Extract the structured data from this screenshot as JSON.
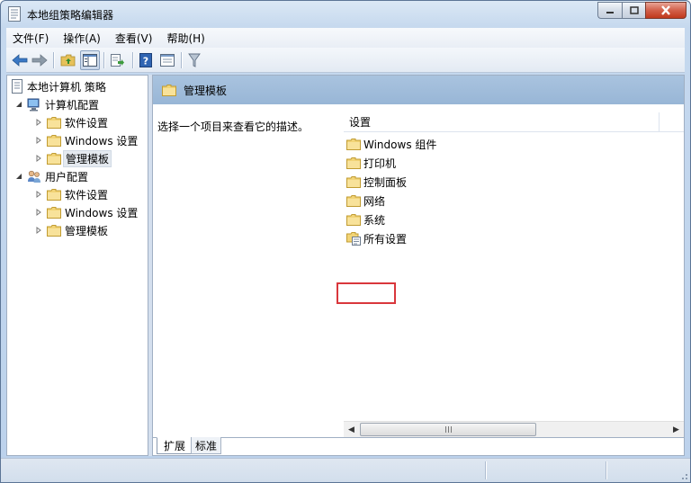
{
  "window": {
    "title": "本地组策略编辑器"
  },
  "menu": [
    "文件(F)",
    "操作(A)",
    "查看(V)",
    "帮助(H)"
  ],
  "toolbar": {
    "icons": [
      "back-arrow-icon",
      "forward-arrow-icon",
      "folder-up-icon",
      "show-tree-icon",
      "export-icon",
      "help-icon",
      "properties-icon",
      "filter-icon"
    ]
  },
  "tree": {
    "root": "本地计算机 策略",
    "computer_config": "计算机配置",
    "computer_children": [
      "软件设置",
      "Windows 设置",
      "管理模板"
    ],
    "user_config": "用户配置",
    "user_children": [
      "软件设置",
      "Windows 设置",
      "管理模板"
    ],
    "selected": "管理模板"
  },
  "content": {
    "header_title": "管理模板",
    "description": "选择一个项目来查看它的描述。",
    "column_header": "设置",
    "items": [
      "Windows 组件",
      "打印机",
      "控制面板",
      "网络",
      "系统",
      "所有设置"
    ],
    "highlighted_item": "系统"
  },
  "tabs": {
    "expand": "扩展",
    "standard": "标准"
  },
  "colors": {
    "highlight_border": "#d9373c",
    "header_bg": "#9fbcda",
    "window_frame": "#bcd2ec"
  }
}
